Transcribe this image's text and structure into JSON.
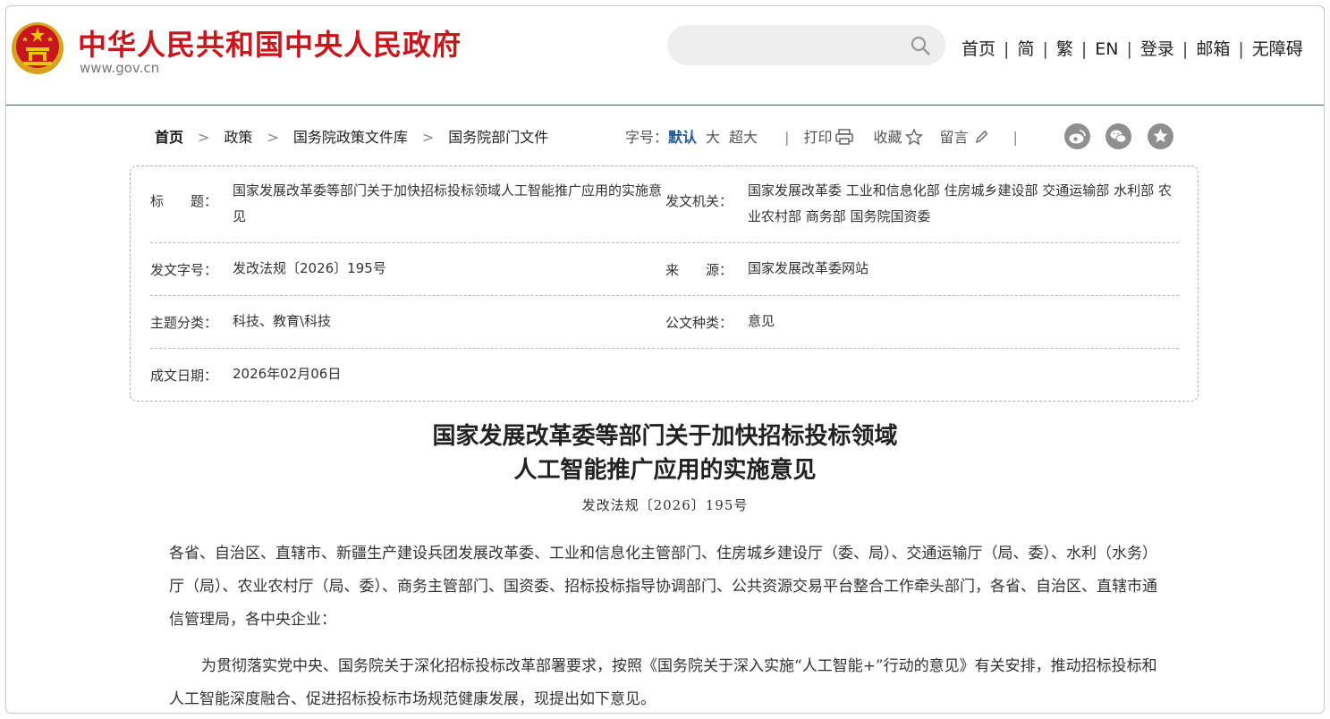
{
  "header": {
    "site_title": "中华人民共和国中央人民政府",
    "site_url": "www.gov.cn",
    "search_placeholder": "",
    "nav": [
      "首页",
      "简",
      "繁",
      "EN",
      "登录",
      "邮箱",
      "无障碍"
    ],
    "nav_separator": "|"
  },
  "breadcrumb": {
    "items": [
      "首页",
      "政策",
      "国务院政策文件库",
      "国务院部门文件"
    ],
    "separator": ">"
  },
  "tools": {
    "font_size_label": "字号：",
    "font_default": "默认",
    "font_large": "大",
    "font_xlarge": "超大",
    "divider": "|",
    "print": "打印",
    "favorite": "收藏",
    "comment": "留言"
  },
  "info": {
    "title_label": "标　　题：",
    "title_value": "国家发展改革委等部门关于加快招标投标领域人工智能推广应用的实施意见",
    "issuer_label": "发文机关：",
    "issuer_value": "国家发展改革委  工业和信息化部  住房城乡建设部  交通运输部  水利部  农业农村部  商务部  国务院国资委",
    "doc_no_label": "发文字号：",
    "doc_no_value": "发改法规〔2026〕195号",
    "source_label": "来　　源：",
    "source_value": "国家发展改革委网站",
    "topic_label": "主题分类：",
    "topic_value": "科技、教育\\科技",
    "type_label": "公文种类：",
    "type_value": "意见",
    "date_label": "成文日期：",
    "date_value": "2026年02月06日"
  },
  "document": {
    "title_line1": "国家发展改革委等部门关于加快招标投标领域",
    "title_line2": "人工智能推广应用的实施意见",
    "number": "发改法规〔2026〕195号",
    "para1": "各省、自治区、直辖市、新疆生产建设兵团发展改革委、工业和信息化主管部门、住房城乡建设厅（委、局）、交通运输厅（局、委）、水利（水务）厅（局）、农业农村厅（局、委）、商务主管部门、国资委、招标投标指导协调部门、公共资源交易平台整合工作牵头部门，各省、自治区、直辖市通信管理局，各中央企业：",
    "para2": "为贯彻落实党中央、国务院关于深化招标投标改革部署要求，按照《国务院关于深入实施“人工智能+”行动的意见》有关安排，推动招标投标和人工智能深度融合、促进招标投标市场规范健康发展，现提出如下意见。"
  },
  "colors": {
    "brand_red": "#c8161d",
    "link_blue": "#1e5a9a",
    "header_rule": "#3f5a66"
  }
}
